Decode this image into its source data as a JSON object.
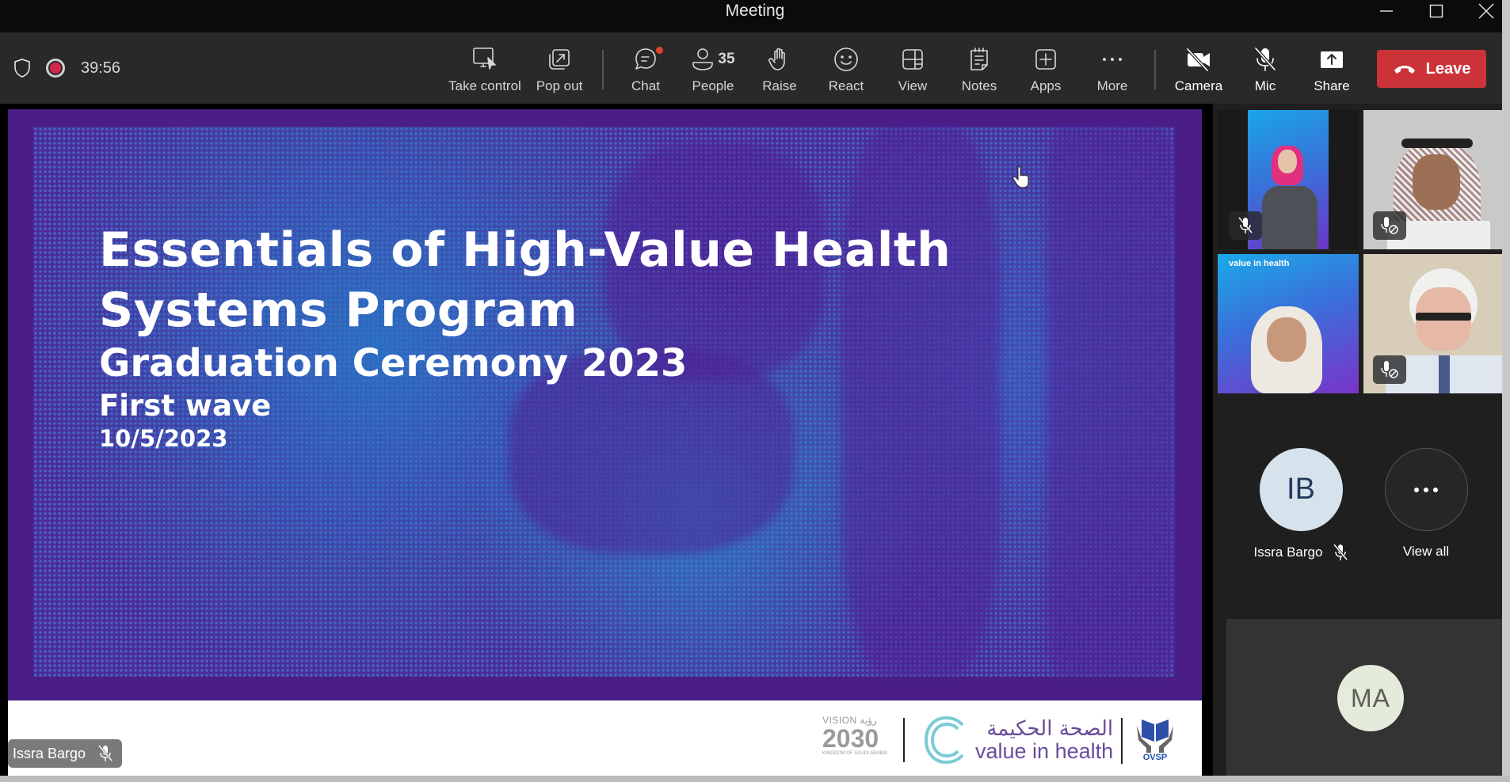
{
  "window": {
    "title": "Meeting",
    "controls": [
      "minimize",
      "maximize",
      "close"
    ]
  },
  "toolbar": {
    "timer": "39:56",
    "recording": true,
    "buttons": [
      {
        "id": "take-control",
        "label": "Take control",
        "icon": "screen-pointer-icon"
      },
      {
        "id": "pop-out",
        "label": "Pop out",
        "icon": "pop-out-icon"
      },
      {
        "id": "chat",
        "label": "Chat",
        "icon": "chat-icon",
        "has_notification": true
      },
      {
        "id": "people",
        "label": "People",
        "icon": "person-icon",
        "count": "35"
      },
      {
        "id": "raise",
        "label": "Raise",
        "icon": "hand-icon"
      },
      {
        "id": "react",
        "label": "React",
        "icon": "smiley-icon"
      },
      {
        "id": "view",
        "label": "View",
        "icon": "layout-icon"
      },
      {
        "id": "notes",
        "label": "Notes",
        "icon": "notes-icon"
      },
      {
        "id": "apps",
        "label": "Apps",
        "icon": "add-app-icon"
      },
      {
        "id": "more",
        "label": "More",
        "icon": "ellipsis-icon"
      },
      {
        "id": "camera",
        "label": "Camera",
        "icon": "camera-off-icon"
      },
      {
        "id": "mic",
        "label": "Mic",
        "icon": "mic-off-icon"
      },
      {
        "id": "share",
        "label": "Share",
        "icon": "share-icon"
      }
    ],
    "leave_label": "Leave",
    "leave_color": "#cc3339"
  },
  "slide": {
    "title_line1": "Essentials of High-Value Health",
    "title_line2": "Systems Program",
    "subtitle": "Graduation Ceremony 2023",
    "wave": "First wave",
    "date": "10/5/2023",
    "logos": {
      "vision_label": "VISION",
      "vision_arabic": "رؤية",
      "vision_year": "2030",
      "vision_country": "KINGDOM OF SAUDI ARABIA",
      "vih_arabic": "الصحة الحكيمة",
      "vih_english": "value in health",
      "ovsp": "OVSP"
    }
  },
  "presenter_tag": {
    "name": "Issra Bargo",
    "muted": true
  },
  "gallery": {
    "video_tiles": [
      {
        "id": "participant-1",
        "mic": "muted"
      },
      {
        "id": "participant-2",
        "mic": "mic-blocked"
      },
      {
        "id": "participant-3",
        "mic": "none"
      },
      {
        "id": "participant-4",
        "mic": "mic-blocked"
      }
    ],
    "avatar_tile": {
      "initials": "IB",
      "name": "Issra Bargo",
      "muted": true
    },
    "view_all_label": "View all",
    "self_tile": {
      "initials": "MA"
    }
  }
}
